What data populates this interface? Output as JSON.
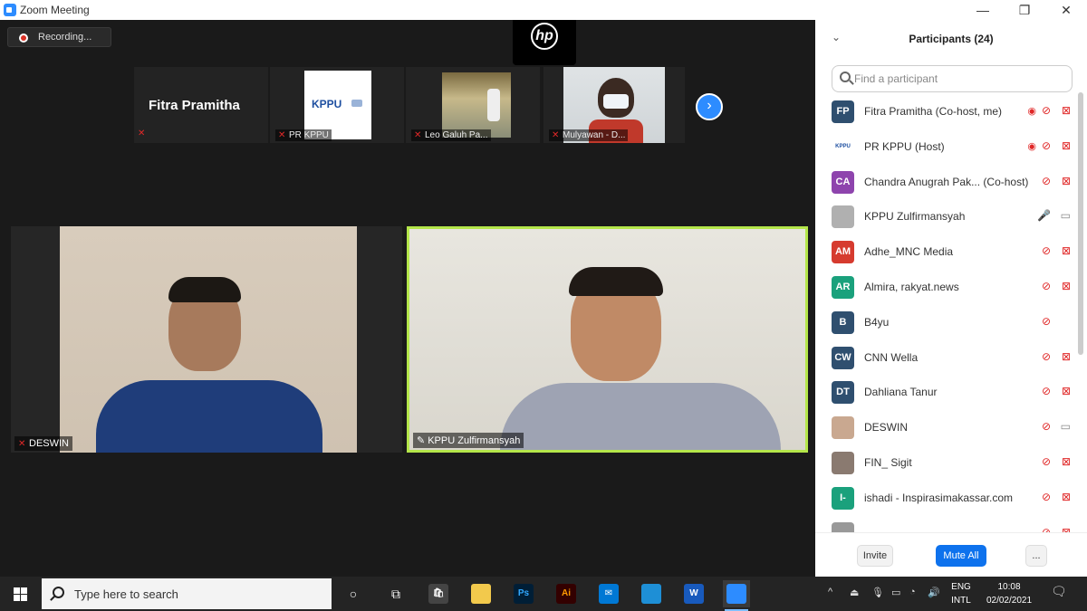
{
  "window": {
    "title": "Zoom Meeting",
    "controls": {
      "minimize": "—",
      "maximize": "❐",
      "close": "✕"
    }
  },
  "meeting": {
    "recording_label": "Recording...",
    "hp_logo_text": "hp",
    "thumbnails": [
      {
        "name": "Fitra Pramitha",
        "label": "",
        "muted": true
      },
      {
        "name": "PR KPPU",
        "label": "PR KPPU",
        "logo_text": "KPPU",
        "muted": true
      },
      {
        "name": "Leo Galuh Pa...",
        "label": "Leo Galuh Pa...",
        "muted": true
      },
      {
        "name": "Mulyawan - D...",
        "label": "Mulyawan - D...",
        "muted": true
      }
    ],
    "tiles": [
      {
        "label": "DESWIN",
        "muted": true
      },
      {
        "label": "KPPU Zulfirmansyah",
        "active_speaker": true
      }
    ],
    "next_icon": "›"
  },
  "participants": {
    "header": "Participants (24)",
    "search_placeholder": "Find a participant",
    "list": [
      {
        "initials": "FP",
        "color": "#2f4f6f",
        "name": "Fitra Pramitha (Co-host, me)",
        "rec": true,
        "mic": "muted",
        "video": "off"
      },
      {
        "initials": "KPPU",
        "color": "#ffffff",
        "name": "PR KPPU (Host)",
        "rec": true,
        "mic": "muted",
        "video": "off"
      },
      {
        "initials": "CA",
        "color": "#8e44ad",
        "name": "Chandra Anugrah Pak... (Co-host)",
        "rec": false,
        "mic": "muted",
        "video": "off"
      },
      {
        "initials": "",
        "color": "#b0b0b0",
        "name": "KPPU Zulfirmansyah",
        "rec": false,
        "mic": "on",
        "video": "on"
      },
      {
        "initials": "AM",
        "color": "#d63b2f",
        "name": "Adhe_MNC Media",
        "rec": false,
        "mic": "muted",
        "video": "off"
      },
      {
        "initials": "AR",
        "color": "#1aa17c",
        "name": "Almira, rakyat.news",
        "rec": false,
        "mic": "muted",
        "video": "off"
      },
      {
        "initials": "B",
        "color": "#2f4f6f",
        "name": "B4yu",
        "rec": false,
        "mic": "muted",
        "video": "none"
      },
      {
        "initials": "CW",
        "color": "#2f4f6f",
        "name": "CNN Wella",
        "rec": false,
        "mic": "muted",
        "video": "off"
      },
      {
        "initials": "DT",
        "color": "#2f4f6f",
        "name": "Dahliana Tanur",
        "rec": false,
        "mic": "muted",
        "video": "off"
      },
      {
        "initials": "",
        "color": "#c9a890",
        "name": "DESWIN",
        "rec": false,
        "mic": "muted",
        "video": "on"
      },
      {
        "initials": "",
        "color": "#8a7a70",
        "name": "FIN_ Sigit",
        "rec": false,
        "mic": "muted",
        "video": "off"
      },
      {
        "initials": "I-",
        "color": "#1aa17c",
        "name": "ishadi - Inspirasimakassar.com",
        "rec": false,
        "mic": "muted",
        "video": "off"
      },
      {
        "initials": "",
        "color": "#999999",
        "name": "",
        "rec": false,
        "mic": "muted",
        "video": "off"
      }
    ],
    "buttons": {
      "invite": "Invite",
      "mute_all": "Mute All",
      "more": "..."
    }
  },
  "taskbar": {
    "search_placeholder": "Type here to search",
    "apps": [
      {
        "name": "cortana",
        "glyph": "○"
      },
      {
        "name": "task-view",
        "glyph": "⧉"
      },
      {
        "name": "store",
        "glyph": "🛍"
      },
      {
        "name": "file-explorer",
        "glyph": ""
      },
      {
        "name": "photoshop",
        "glyph": "Ps"
      },
      {
        "name": "illustrator",
        "glyph": "Ai"
      },
      {
        "name": "mail",
        "glyph": "✉"
      },
      {
        "name": "edge",
        "glyph": ""
      },
      {
        "name": "word",
        "glyph": "W"
      },
      {
        "name": "zoom",
        "glyph": ""
      }
    ],
    "tray": {
      "chevron": "^",
      "lang_top": "ENG",
      "lang_bottom": "INTL",
      "time": "10:08",
      "date": "02/02/2021"
    }
  }
}
